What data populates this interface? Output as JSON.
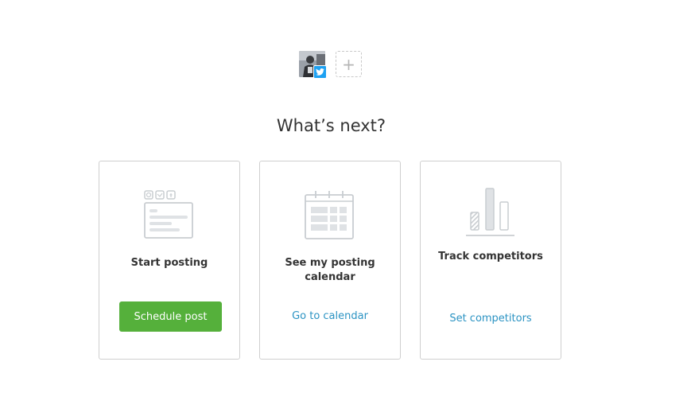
{
  "accounts": {
    "connected": [
      {
        "network": "twitter",
        "avatar_icon": "user-photo",
        "badge_icon": "twitter-icon",
        "badge_color": "#1da1f2"
      }
    ],
    "add_label": "+"
  },
  "heading": "What’s next?",
  "cards": [
    {
      "icon": "post-editor-icon",
      "title": "Start posting",
      "action_label": "Schedule post",
      "action_type": "button",
      "action_color": "#55b03b"
    },
    {
      "icon": "calendar-icon",
      "title": "See my posting calendar",
      "action_label": "Go to calendar",
      "action_type": "link",
      "action_color": "#2b93c3"
    },
    {
      "icon": "bar-chart-icon",
      "title": "Track competitors",
      "action_label": "Set competitors",
      "action_type": "link",
      "action_color": "#2b93c3"
    }
  ]
}
